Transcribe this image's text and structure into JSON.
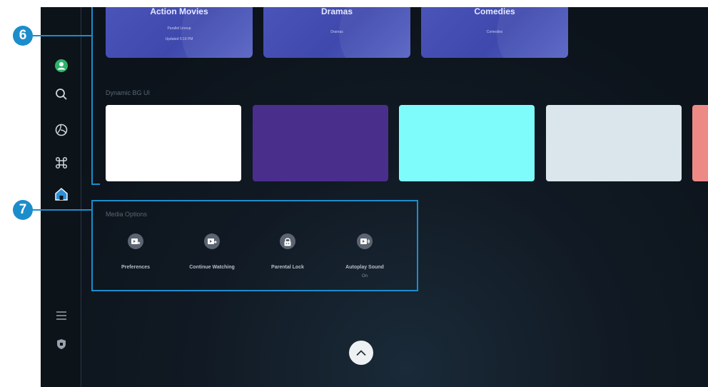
{
  "categories": [
    {
      "title": "Action Movies",
      "line1": "Parallel Lineup",
      "line2": "Updated 5:19 PM"
    },
    {
      "title": "Dramas",
      "line1": "Dramas"
    },
    {
      "title": "Comedies",
      "line1": "Comedies"
    }
  ],
  "dynamic_bg": {
    "label": "Dynamic BG UI",
    "swatches": [
      "#ffffff",
      "#4a2e8c",
      "#7efcfc",
      "#dbe6ec",
      "#ee8a86"
    ]
  },
  "media_options": {
    "label": "Media Options",
    "items": [
      {
        "label": "Preferences",
        "icon": "video-star-icon"
      },
      {
        "label": "Continue Watching",
        "icon": "video-forward-icon"
      },
      {
        "label": "Parental Lock",
        "icon": "lock-icon"
      },
      {
        "label": "Autoplay Sound",
        "icon": "video-sound-icon",
        "value": "On"
      }
    ]
  },
  "sidebar": {
    "items": [
      {
        "name": "profile",
        "icon": "profile-icon"
      },
      {
        "name": "search",
        "icon": "search-icon"
      },
      {
        "name": "ambient",
        "icon": "ambient-icon"
      },
      {
        "name": "apps",
        "icon": "apps-icon"
      },
      {
        "name": "home",
        "icon": "home-icon"
      },
      {
        "name": "menu",
        "icon": "menu-icon"
      },
      {
        "name": "privacy",
        "icon": "shield-icon"
      }
    ]
  },
  "callouts": {
    "six": "6",
    "seven": "7"
  },
  "colors": {
    "accent": "#1c8dcb",
    "category_card": "#4b54b8",
    "profile": "#2db36a"
  }
}
